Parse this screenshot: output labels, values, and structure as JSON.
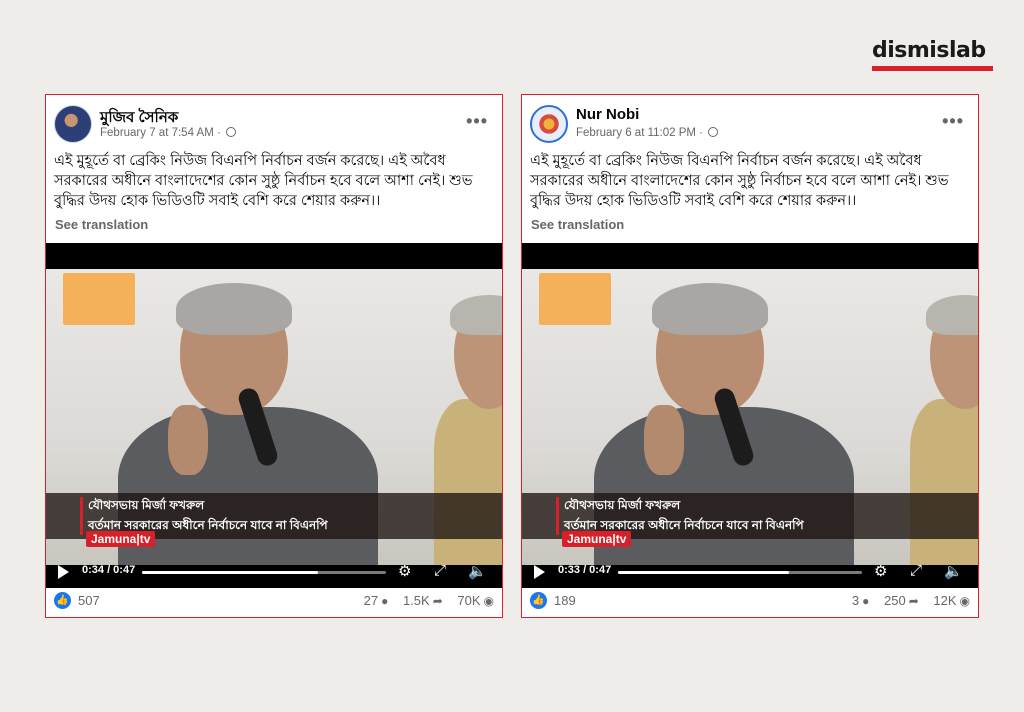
{
  "brand": {
    "name": "dismislab"
  },
  "posts": [
    {
      "author": "মুজিব সৈনিক",
      "timestamp": "February 7 at 7:54 AM",
      "text": "এই মুহূর্তে বা ব্রেকিং নিউজ বিএনপি নির্বাচন বর্জন করেছে। এই অবৈধ সরকারের অধীনে বাংলাদেশের কোন সুষ্ঠু নির্বাচন হবে বলে আশা নেই। শুভ বুদ্ধির উদয় হোক ভিডিওটি সবাই বেশি করে শেয়ার করুন।।",
      "see_translation": "See translation",
      "video": {
        "caption_line1": "যৌথসভায় মির্জা ফখরুল",
        "caption_line2": "বর্তমান সরকারের অধীনে নির্বাচনে যাবে না বিএনপি",
        "channel": "Jamuna|tv",
        "time": "0:34 / 0:47",
        "progress": 0.72
      },
      "reactions": "507",
      "comments": "27",
      "shares": "1.5K",
      "views": "70K"
    },
    {
      "author": "Nur Nobi",
      "timestamp": "February 6 at 11:02 PM",
      "text": "এই মুহূর্তে বা ব্রেকিং নিউজ বিএনপি নির্বাচন বর্জন করেছে। এই অবৈধ সরকারের অধীনে বাংলাদেশের কোন সুষ্ঠু নির্বাচন হবে বলে আশা নেই। শুভ বুদ্ধির উদয় হোক ভিডিওটি সবাই বেশি করে শেয়ার করুন।।",
      "see_translation": "See translation",
      "video": {
        "caption_line1": "যৌথসভায় মির্জা ফখরুল",
        "caption_line2": "বর্তমান সরকারের অধীনে নির্বাচনে যাবে না বিএনপি",
        "channel": "Jamuna|tv",
        "time": "0:33 / 0:47",
        "progress": 0.7
      },
      "reactions": "189",
      "comments": "3",
      "shares": "250",
      "views": "12K"
    }
  ]
}
